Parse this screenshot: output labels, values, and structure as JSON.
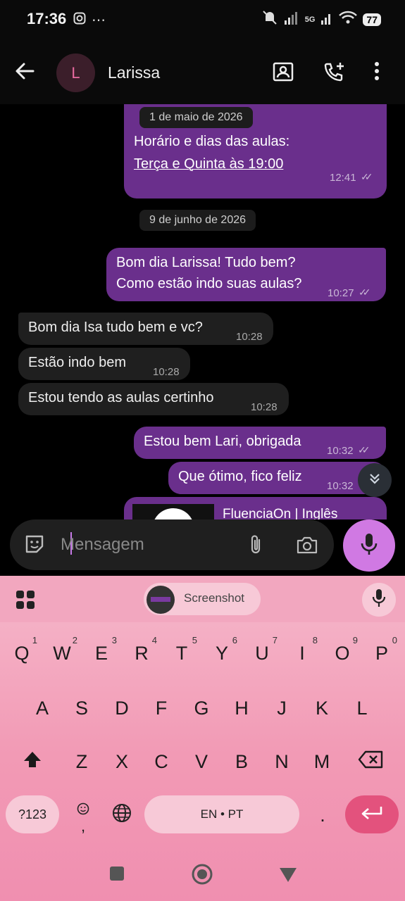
{
  "status_bar": {
    "time": "17:36",
    "battery": "77",
    "network": "5G"
  },
  "header": {
    "avatar_letter": "L",
    "contact_name": "Larissa"
  },
  "chat": {
    "date_top": "1 de maio de 2026",
    "msg1_line1": "Horário e dias das aulas:",
    "msg1_line2": "Terça e Quinta às 19:00",
    "msg1_time": "12:41",
    "date_mid": "9 de junho de 2026",
    "msg2_line1": "Bom dia Larissa! Tudo bem?",
    "msg2_line2": "Como estão indo suas aulas?",
    "msg2_time": "10:27",
    "msg3": "Bom dia Isa tudo bem e vc?",
    "msg3_time": "10:28",
    "msg4": "Estão indo bem",
    "msg4_time": "10:28",
    "msg5": "Estou tendo as aulas certinho",
    "msg5_time": "10:28",
    "msg6": "Estou bem Lari, obrigada",
    "msg6_time": "10:32",
    "msg7": "Que ótimo, fico feliz",
    "msg7_time": "10:32",
    "msg8_partial": "FluenciaOn | Inglês"
  },
  "composer": {
    "placeholder": "Mensagem"
  },
  "keyboard": {
    "suggestion_chip": "Screenshot",
    "row1": [
      {
        "k": "Q",
        "n": "1"
      },
      {
        "k": "W",
        "n": "2"
      },
      {
        "k": "E",
        "n": "3"
      },
      {
        "k": "R",
        "n": "4"
      },
      {
        "k": "T",
        "n": "5"
      },
      {
        "k": "Y",
        "n": "6"
      },
      {
        "k": "U",
        "n": "7"
      },
      {
        "k": "I",
        "n": "8"
      },
      {
        "k": "O",
        "n": "9"
      },
      {
        "k": "P",
        "n": "0"
      }
    ],
    "row2": [
      "A",
      "S",
      "D",
      "F",
      "G",
      "H",
      "J",
      "K",
      "L"
    ],
    "row3": [
      "Z",
      "X",
      "C",
      "V",
      "B",
      "N",
      "M"
    ],
    "symbols_key": "?123",
    "emoji_key": ",",
    "space_label": "EN • PT",
    "period_key": "."
  },
  "colors": {
    "outgoing": "#6a2f8c",
    "incoming": "#1f1f1f",
    "accent": "#d079e3",
    "keyboard": "#f29ab5"
  }
}
